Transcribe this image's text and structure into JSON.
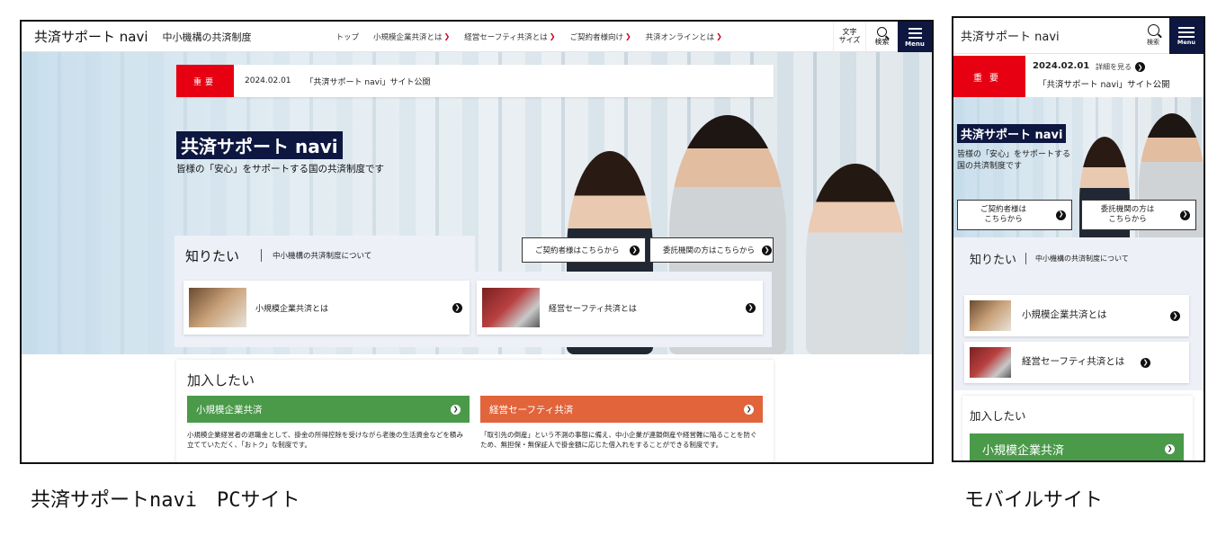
{
  "pc": {
    "logo": "共済サポート navi",
    "sublogo": "中小機構の共済制度",
    "nav": [
      {
        "label": "トップ",
        "has_menu": false
      },
      {
        "label": "小規模企業共済とは",
        "has_menu": true
      },
      {
        "label": "経営セーフティ共済とは",
        "has_menu": true
      },
      {
        "label": "ご契約者様向け",
        "has_menu": true
      },
      {
        "label": "共済オンラインとは",
        "has_menu": true
      }
    ],
    "tools": {
      "font_size_line1": "文字",
      "font_size_line2": "サイズ",
      "search": "検索",
      "menu": "Menu"
    },
    "news": {
      "badge": "重要",
      "date": "2024.02.01",
      "text": "「共済サポート navi」サイト公開"
    },
    "hero": {
      "title": "共済サポート navi",
      "lead": "皆様の「安心」をサポートする国の共済制度です"
    },
    "cta": {
      "contractor": "ご契約者様はこちらから",
      "agency": "委託機関の方はこちらから"
    },
    "know": {
      "title": "知りたい",
      "subtitle": "中小機構の共済制度について",
      "cards": [
        {
          "label": "小規模企業共済とは"
        },
        {
          "label": "経営セーフティ共済とは"
        }
      ]
    },
    "join": {
      "title": "加入したい",
      "items": [
        {
          "label": "小規模企業共済",
          "color": "#4a9a4a",
          "desc": "小規模企業経営者の退職金として、掛金の所得控除を受けながら老後の生活資金などを積み立てていただく、「おトク」な制度です。"
        },
        {
          "label": "経営セーフティ共済",
          "color": "#e2643a",
          "desc": "「取引先の倒産」という不測の事態に備え、中小企業が連鎖倒産や経営難に陥ることを防ぐため、無担保・無保証人で掛金額に応じた借入れをすることができる制度です。"
        }
      ]
    }
  },
  "mobile": {
    "logo": "共済サポート navi",
    "search": "検索",
    "menu": "Menu",
    "news": {
      "badge": "重要",
      "date": "2024.02.01",
      "more": "詳細を見る",
      "text": "「共済サポート navi」サイト公開"
    },
    "hero": {
      "title": "共済サポート navi",
      "lead": "皆様の「安心」をサポートする国の共済制度です"
    },
    "cta": {
      "contractor_line1": "ご契約者様は",
      "contractor_line2": "こちらから",
      "agency_line1": "委託機関の方は",
      "agency_line2": "こちらから"
    },
    "know": {
      "title": "知りたい",
      "subtitle": "中小機構の共済制度について",
      "cards": [
        {
          "label": "小規模企業共済とは"
        },
        {
          "label": "経営セーフティ共済とは"
        }
      ]
    },
    "join": {
      "title": "加入したい",
      "button": "小規模企業共済"
    }
  },
  "captions": {
    "pc": "共済サポートnavi　PCサイト",
    "mobile": "モバイルサイト"
  },
  "colors": {
    "brand_navy": "#0d1740",
    "important_red": "#e60012",
    "join_green": "#4a9a4a",
    "join_orange": "#e2643a",
    "chevron_red": "#d0021b"
  },
  "icons": [
    "search-icon",
    "hamburger-menu-icon",
    "chevron-down-icon",
    "arrow-circle-icon"
  ]
}
